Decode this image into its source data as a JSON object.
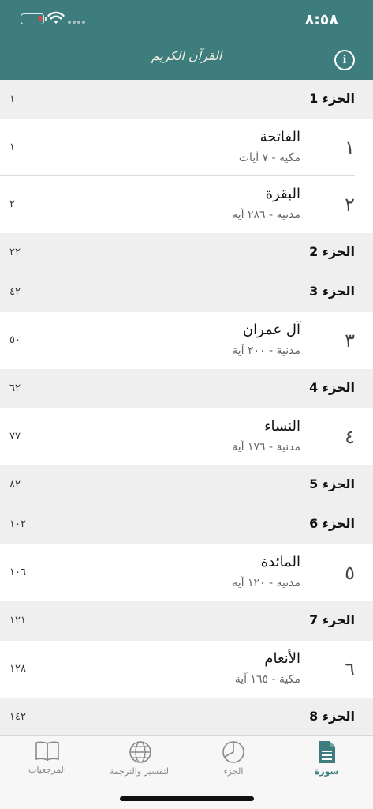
{
  "status": {
    "time": "٨:٥٨"
  },
  "header": {
    "logo_text": "القرآن الكريم",
    "info_label": "i"
  },
  "list": [
    {
      "kind": "juz",
      "title": "الجزء 1",
      "page": "١"
    },
    {
      "kind": "surah",
      "number": "١",
      "name": "الفاتحة",
      "meta": "مكية - ٧ آيات",
      "page": "١",
      "divider": true
    },
    {
      "kind": "surah",
      "number": "٢",
      "name": "البقرة",
      "meta": "مدنية - ٢٨٦ آية",
      "page": "٢"
    },
    {
      "kind": "juz",
      "title": "الجزء 2",
      "page": "٢٢"
    },
    {
      "kind": "juz",
      "title": "الجزء 3",
      "page": "٤٢"
    },
    {
      "kind": "surah",
      "number": "٣",
      "name": "آل عمران",
      "meta": "مدنية - ٢٠٠ آية",
      "page": "٥٠"
    },
    {
      "kind": "juz",
      "title": "الجزء 4",
      "page": "٦٢"
    },
    {
      "kind": "surah",
      "number": "٤",
      "name": "النساء",
      "meta": "مدنية - ١٧٦ آية",
      "page": "٧٧"
    },
    {
      "kind": "juz",
      "title": "الجزء 5",
      "page": "٨٢"
    },
    {
      "kind": "juz",
      "title": "الجزء 6",
      "page": "١٠٢"
    },
    {
      "kind": "surah",
      "number": "٥",
      "name": "المائدة",
      "meta": "مدنية - ١٢٠ آية",
      "page": "١٠٦"
    },
    {
      "kind": "juz",
      "title": "الجزء 7",
      "page": "١٢١"
    },
    {
      "kind": "surah",
      "number": "٦",
      "name": "الأنعام",
      "meta": "مكية - ١٦٥ آية",
      "page": "١٢٨"
    },
    {
      "kind": "juz",
      "title": "الجزء 8",
      "page": "١٤٢"
    }
  ],
  "tabs": {
    "references": "المرجعيات",
    "tafsir": "التفسير والترجمة",
    "juz": "الجزء",
    "surah": "سورة"
  },
  "colors": {
    "primary": "#3d7d7e",
    "section_bg": "#efefef"
  },
  "icons": [
    "battery-icon",
    "wifi-icon",
    "info-icon",
    "book-icon",
    "globe-icon",
    "pie-icon",
    "document-icon"
  ]
}
